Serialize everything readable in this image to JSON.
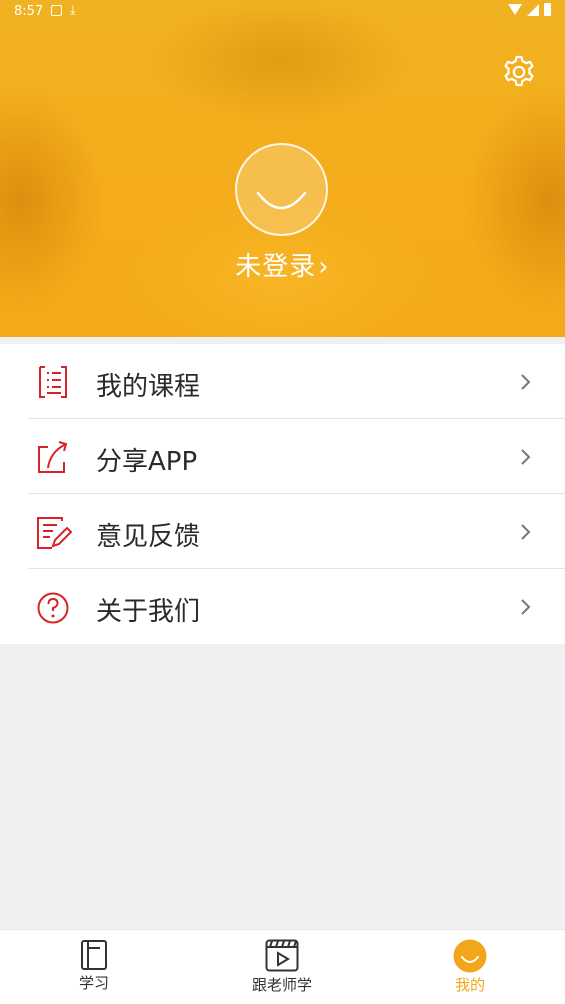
{
  "status_bar": {
    "time": "8:57"
  },
  "header": {
    "login_text": "未登录",
    "login_chevron": "›"
  },
  "menu": {
    "items": [
      {
        "label": "我的课程",
        "icon": "course-list-icon"
      },
      {
        "label": "分享APP",
        "icon": "share-icon"
      },
      {
        "label": "意见反馈",
        "icon": "feedback-edit-icon"
      },
      {
        "label": "关于我们",
        "icon": "question-circle-icon"
      }
    ]
  },
  "tabbar": {
    "tabs": [
      {
        "label": "学习",
        "icon": "notebook-icon",
        "active": false
      },
      {
        "label": "跟老师学",
        "icon": "video-play-icon",
        "active": false
      },
      {
        "label": "我的",
        "icon": "smile-face-icon",
        "active": true
      }
    ]
  },
  "colors": {
    "brand_orange": "#f3a51b",
    "icon_red": "#d8232a",
    "background": "#eef0f1"
  }
}
